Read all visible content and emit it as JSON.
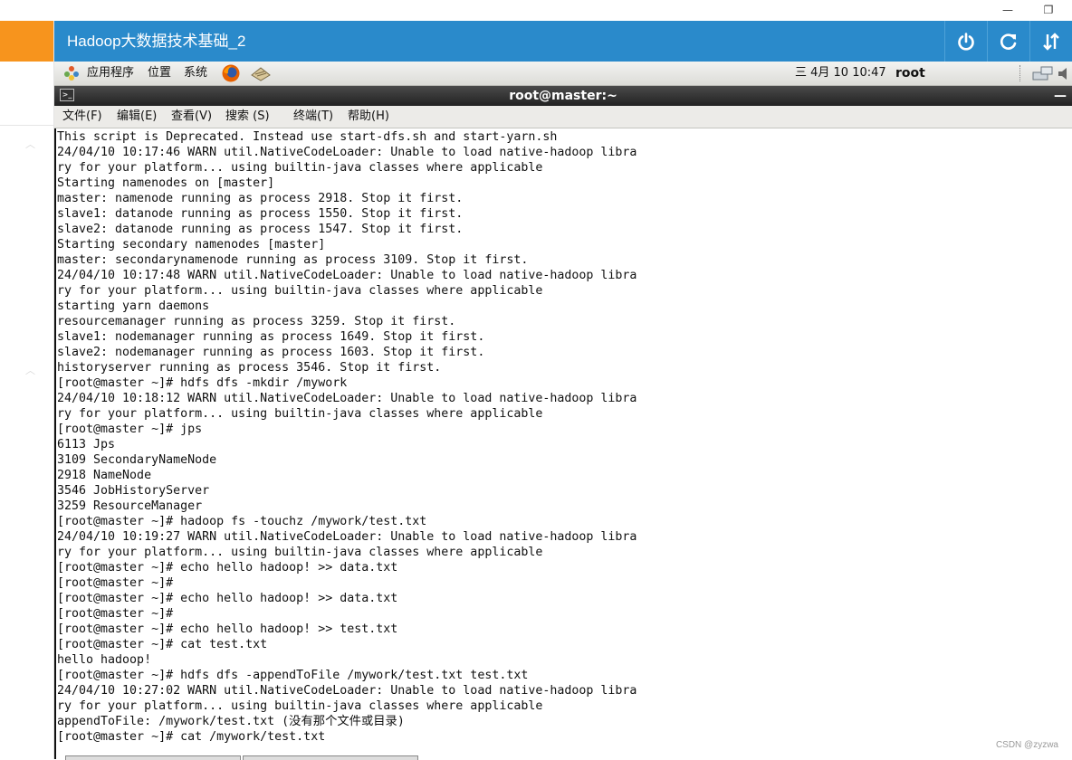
{
  "window": {
    "minimize_glyph": "—",
    "restore_glyph": "❐"
  },
  "header": {
    "title": "Hadoop大数据技术基础_2"
  },
  "panel": {
    "applications": "应用程序",
    "places": "位置",
    "system": "系统",
    "datetime": "三 4月 10 10:47",
    "user": "root"
  },
  "terminal": {
    "title": "root@master:~",
    "menu": [
      "文件(F)",
      "编辑(E)",
      "查看(V)",
      "搜索 (S)",
      "终端(T)",
      "帮助(H)"
    ],
    "lines": [
      "This script is Deprecated. Instead use start-dfs.sh and start-yarn.sh",
      "24/04/10 10:17:46 WARN util.NativeCodeLoader: Unable to load native-hadoop libra",
      "ry for your platform... using builtin-java classes where applicable",
      "Starting namenodes on [master]",
      "master: namenode running as process 2918. Stop it first.",
      "slave1: datanode running as process 1550. Stop it first.",
      "slave2: datanode running as process 1547. Stop it first.",
      "Starting secondary namenodes [master]",
      "master: secondarynamenode running as process 3109. Stop it first.",
      "24/04/10 10:17:48 WARN util.NativeCodeLoader: Unable to load native-hadoop libra",
      "ry for your platform... using builtin-java classes where applicable",
      "starting yarn daemons",
      "resourcemanager running as process 3259. Stop it first.",
      "slave1: nodemanager running as process 1649. Stop it first.",
      "slave2: nodemanager running as process 1603. Stop it first.",
      "historyserver running as process 3546. Stop it first.",
      "[root@master ~]# hdfs dfs -mkdir /mywork",
      "24/04/10 10:18:12 WARN util.NativeCodeLoader: Unable to load native-hadoop libra",
      "ry for your platform... using builtin-java classes where applicable",
      "[root@master ~]# jps",
      "6113 Jps",
      "3109 SecondaryNameNode",
      "2918 NameNode",
      "3546 JobHistoryServer",
      "3259 ResourceManager",
      "[root@master ~]# hadoop fs -touchz /mywork/test.txt",
      "24/04/10 10:19:27 WARN util.NativeCodeLoader: Unable to load native-hadoop libra",
      "ry for your platform... using builtin-java classes where applicable",
      "[root@master ~]# echo hello hadoop! >> data.txt",
      "[root@master ~]#",
      "[root@master ~]# echo hello hadoop! >> data.txt",
      "[root@master ~]#",
      "[root@master ~]# echo hello hadoop! >> test.txt",
      "[root@master ~]# cat test.txt",
      "hello hadoop!",
      "[root@master ~]# hdfs dfs -appendToFile /mywork/test.txt test.txt",
      "24/04/10 10:27:02 WARN util.NativeCodeLoader: Unable to load native-hadoop libra",
      "ry for your platform... using builtin-java classes where applicable",
      "appendToFile: /mywork/test.txt (没有那个文件或目录)",
      "[root@master ~]# cat /mywork/test.txt"
    ]
  },
  "watermark": "CSDN @zyzwa",
  "colors": {
    "header_blue": "#2a8acb",
    "accent_orange": "#f7941d"
  }
}
